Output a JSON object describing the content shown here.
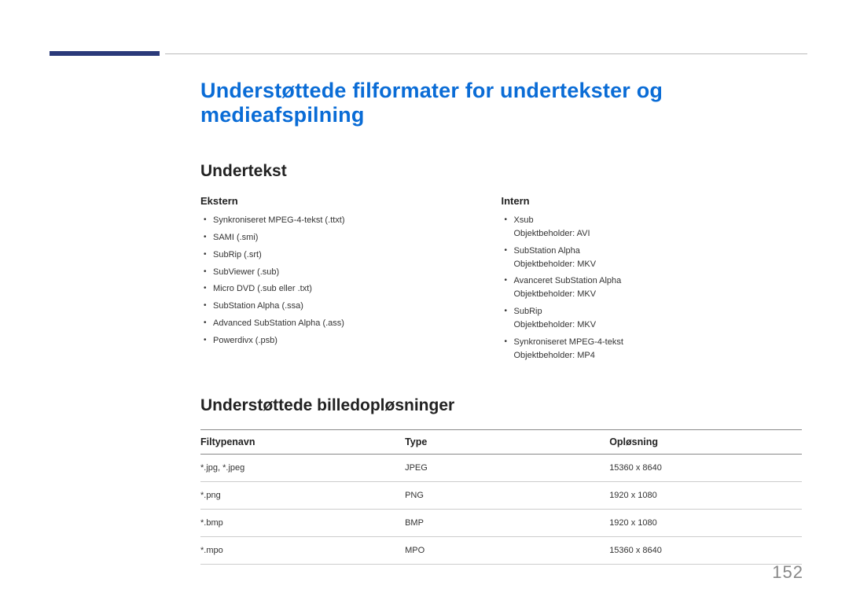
{
  "title": "Understøttede filformater for undertekster og medieafspilning",
  "section1": {
    "heading": "Undertekst",
    "ekstern": {
      "label": "Ekstern",
      "items": [
        "Synkroniseret MPEG-4-tekst (.ttxt)",
        "SAMI (.smi)",
        "SubRip (.srt)",
        "SubViewer (.sub)",
        "Micro DVD (.sub eller .txt)",
        "SubStation Alpha (.ssa)",
        "Advanced SubStation Alpha (.ass)",
        "Powerdivx (.psb)"
      ]
    },
    "intern": {
      "label": "Intern",
      "items": [
        {
          "main": "Xsub",
          "sub": "Objektbeholder: AVI"
        },
        {
          "main": "SubStation Alpha",
          "sub": "Objektbeholder: MKV"
        },
        {
          "main": "Avanceret SubStation Alpha",
          "sub": "Objektbeholder: MKV"
        },
        {
          "main": "SubRip",
          "sub": "Objektbeholder: MKV"
        },
        {
          "main": "Synkroniseret MPEG-4-tekst",
          "sub": "Objektbeholder: MP4"
        }
      ]
    }
  },
  "section2": {
    "heading": "Understøttede billedopløsninger",
    "headers": {
      "filename": "Filtypenavn",
      "type": "Type",
      "resolution": "Opløsning"
    },
    "rows": [
      {
        "filename": "*.jpg, *.jpeg",
        "type": "JPEG",
        "resolution": "15360 x 8640"
      },
      {
        "filename": "*.png",
        "type": "PNG",
        "resolution": "1920 x 1080"
      },
      {
        "filename": "*.bmp",
        "type": "BMP",
        "resolution": "1920 x 1080"
      },
      {
        "filename": "*.mpo",
        "type": "MPO",
        "resolution": "15360 x 8640"
      }
    ]
  },
  "page_number": "152"
}
